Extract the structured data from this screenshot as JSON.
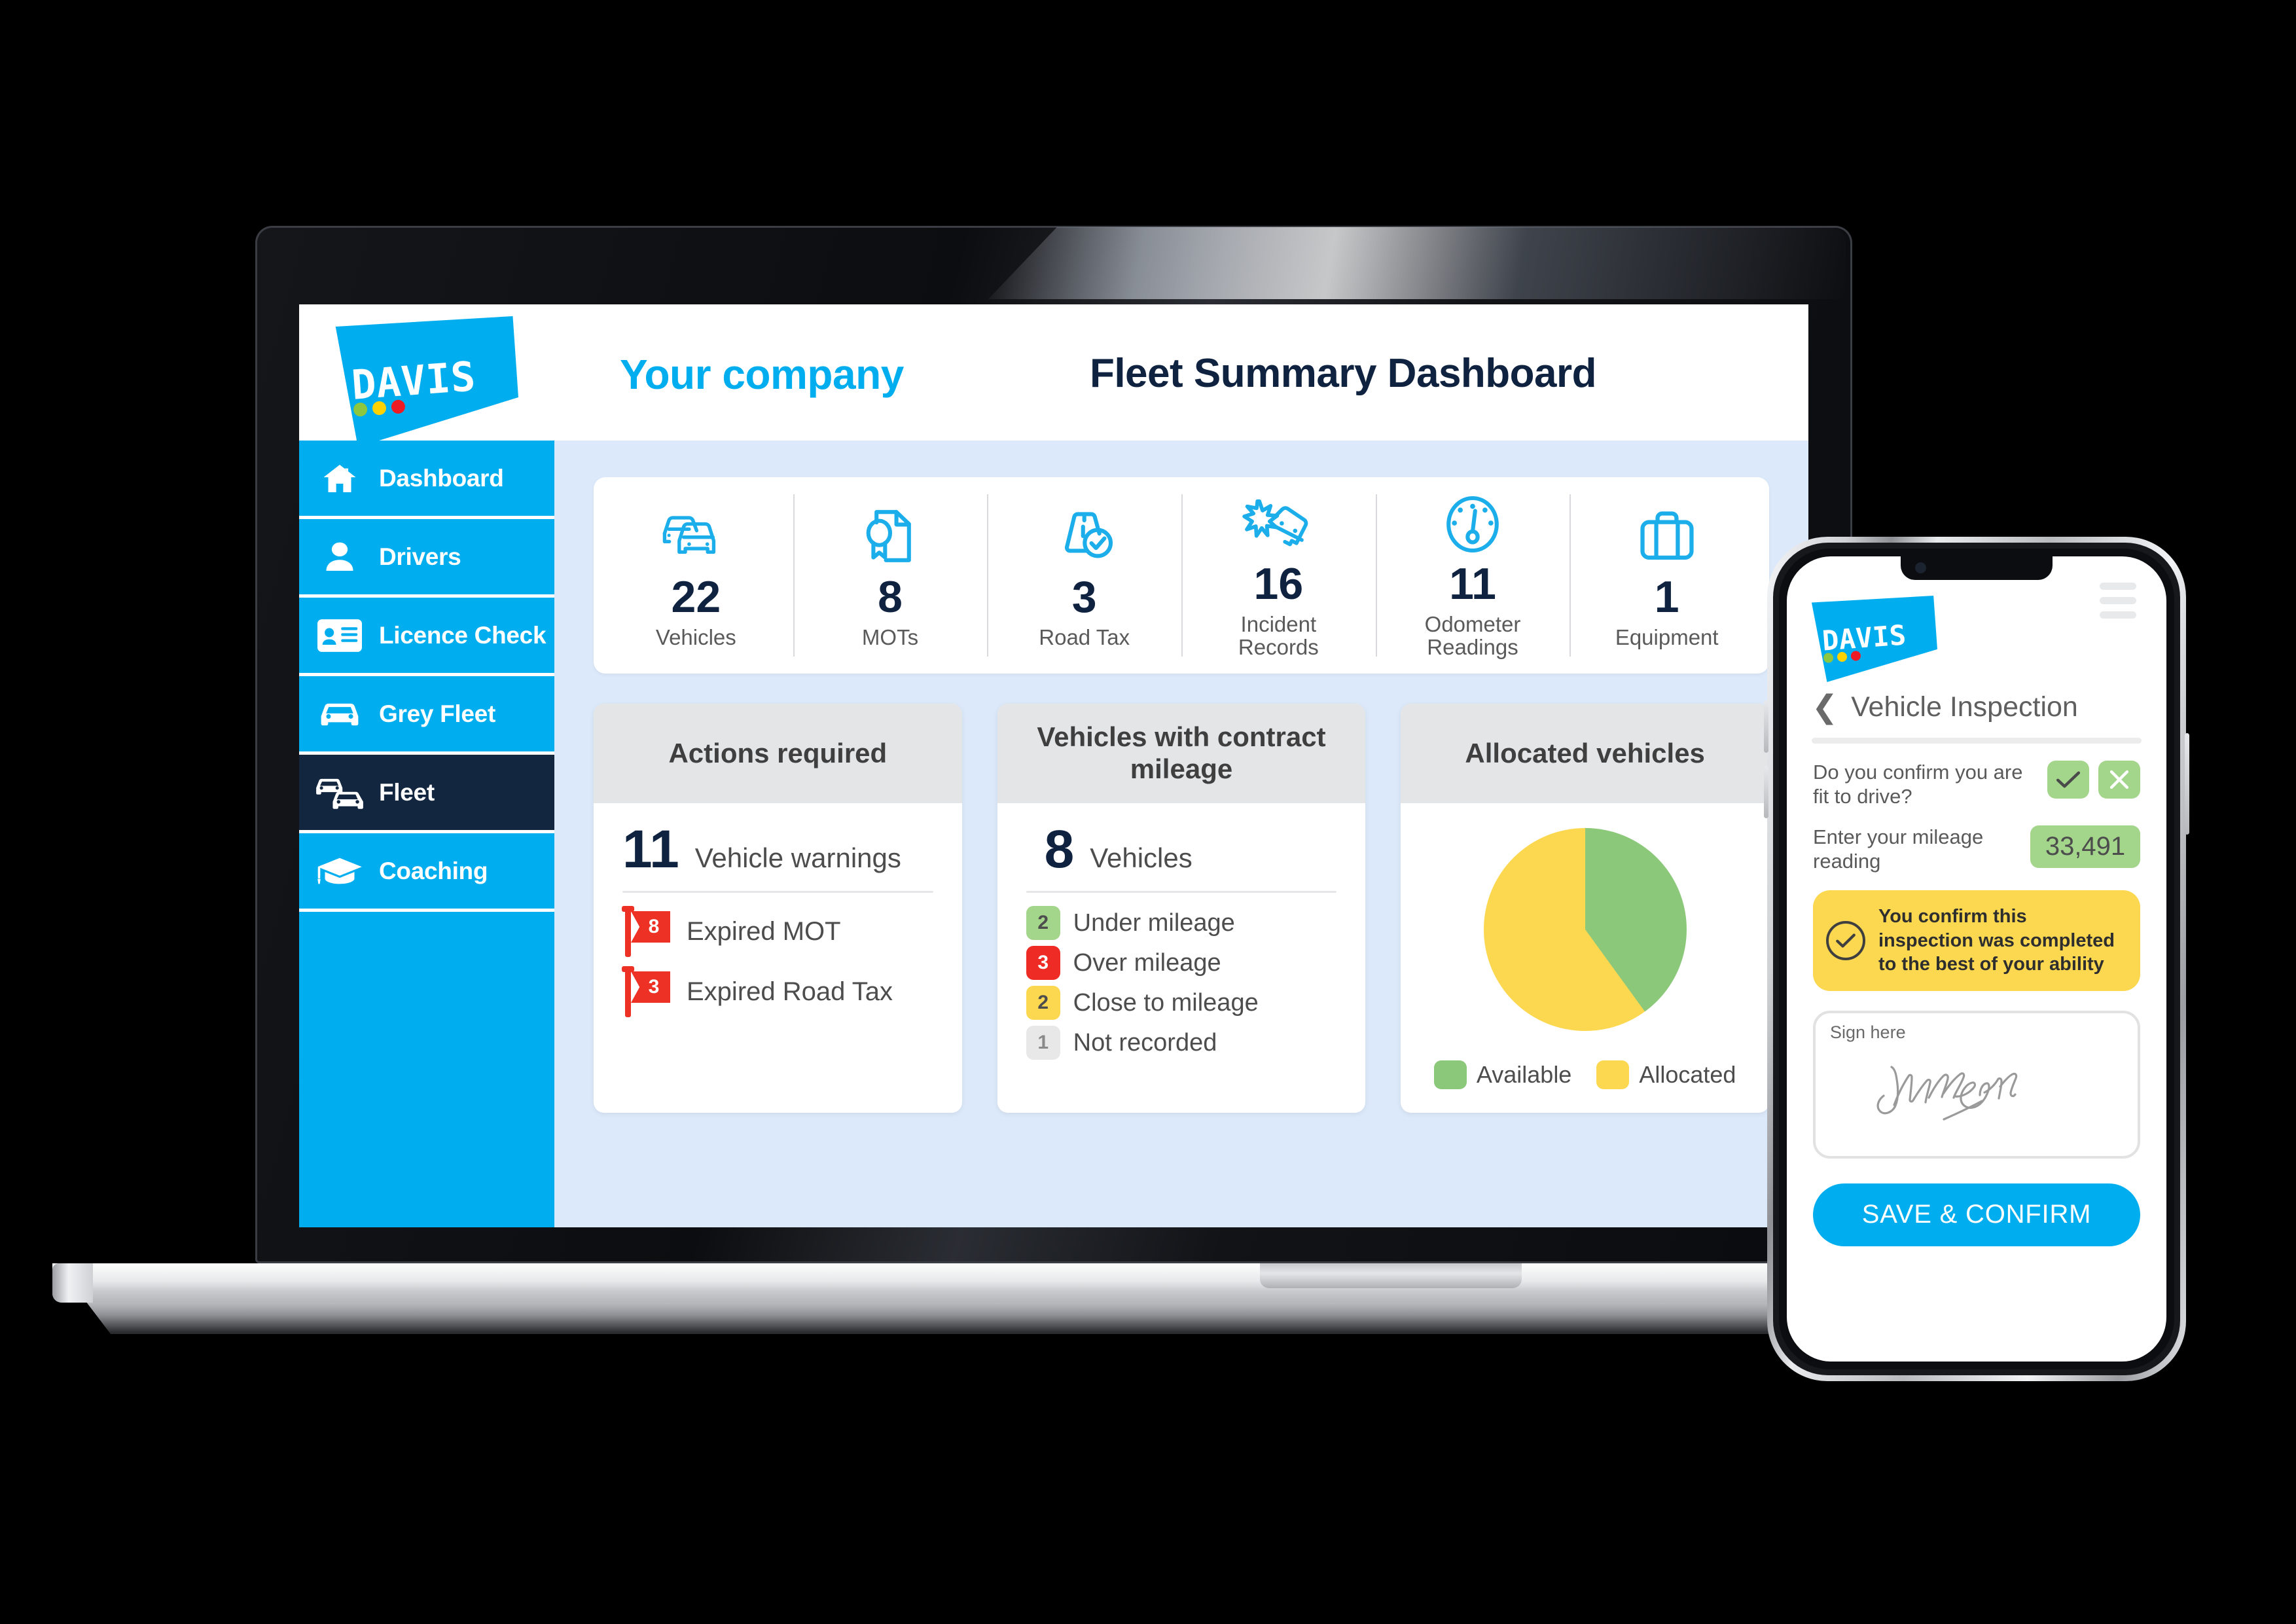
{
  "brand": {
    "name": "DAVIS",
    "logo_dots": [
      "#8DC63F",
      "#FFD200",
      "#ED1C24"
    ],
    "accent": "#00AEEF",
    "dark": "#13263F"
  },
  "dashboard": {
    "company": "Your company",
    "title": "Fleet Summary Dashboard",
    "sidebar": {
      "items": [
        {
          "label": "Dashboard",
          "icon": "home-icon",
          "active": false
        },
        {
          "label": "Drivers",
          "icon": "user-icon",
          "active": false
        },
        {
          "label": "Licence Check",
          "icon": "id-card-icon",
          "active": false
        },
        {
          "label": "Grey Fleet",
          "icon": "car-icon",
          "active": false
        },
        {
          "label": "Fleet",
          "icon": "two-cars-icon",
          "active": true
        },
        {
          "label": "Coaching",
          "icon": "graduation-icon",
          "active": false
        }
      ]
    },
    "stats": [
      {
        "value": "22",
        "label": "Vehicles",
        "icon": "two-cars-icon"
      },
      {
        "value": "8",
        "label": "MOTs",
        "icon": "certificate-icon"
      },
      {
        "value": "3",
        "label": "Road Tax",
        "icon": "road-check-icon"
      },
      {
        "value": "16",
        "label": "Incident\nRecords",
        "icon": "crash-icon"
      },
      {
        "value": "11",
        "label": "Odometer\nReadings",
        "icon": "gauge-icon"
      },
      {
        "value": "1",
        "label": "Equipment",
        "icon": "briefcase-icon"
      }
    ],
    "actions_card": {
      "title": "Actions required",
      "headline_value": "11",
      "headline_label": "Vehicle warnings",
      "rows": [
        {
          "count": "8",
          "label": "Expired MOT",
          "color": "#ED3124"
        },
        {
          "count": "3",
          "label": "Expired Road Tax",
          "color": "#ED3124"
        }
      ]
    },
    "mileage_card": {
      "title": "Vehicles with contract mileage",
      "headline_value": "8",
      "headline_label": "Vehicles",
      "rows": [
        {
          "count": "2",
          "label": "Under mileage",
          "color": "#A3D58B",
          "text_color": "#4d4d4d"
        },
        {
          "count": "3",
          "label": "Over mileage",
          "color": "#EE2B24",
          "text_color": "#ffffff"
        },
        {
          "count": "2",
          "label": "Close to mileage",
          "color": "#FCD851",
          "text_color": "#4d4d4d"
        },
        {
          "count": "1",
          "label": "Not recorded",
          "color": "#E8E8E8",
          "text_color": "#8a8a8a"
        }
      ]
    },
    "allocated_card": {
      "title": "Allocated vehicles",
      "legend": [
        {
          "label": "Available",
          "color": "#8CC87A"
        },
        {
          "label": "Allocated",
          "color": "#FCD851"
        }
      ]
    }
  },
  "chart_data": {
    "type": "pie",
    "title": "Allocated vehicles",
    "categories": [
      "Available",
      "Allocated"
    ],
    "values": [
      40,
      60
    ],
    "unit": "percent",
    "colors": [
      "#8CC87A",
      "#FCD851"
    ],
    "start_angle_deg": 0,
    "direction": "clockwise",
    "legend_position": "bottom",
    "grid": false
  },
  "phone": {
    "menu_icon": "hamburger-icon",
    "back_icon": "chevron-left-icon",
    "screen_title": "Vehicle Inspection",
    "fit_to_drive": {
      "question": "Do you confirm you are fit to drive?",
      "yes_icon": "check-icon",
      "no_icon": "close-icon",
      "selected": "yes"
    },
    "mileage": {
      "label": "Enter your mileage reading",
      "value": "33,491",
      "placeholder": "Mileage"
    },
    "confirm_banner": {
      "icon": "check-circle-icon",
      "text": "You confirm this inspection was completed to the best of your ability"
    },
    "signature": {
      "label": "Sign here",
      "signed": true
    },
    "save_button": "SAVE & CONFIRM"
  }
}
